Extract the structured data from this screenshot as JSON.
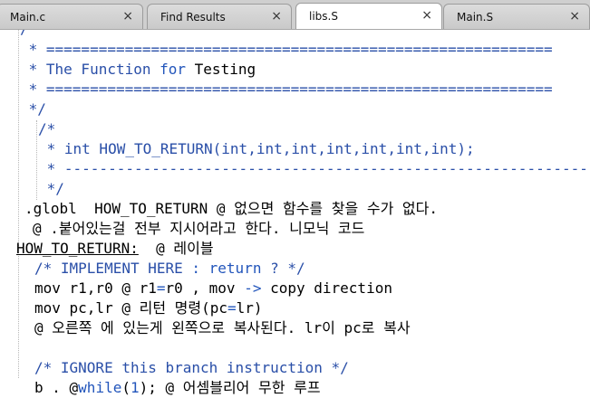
{
  "tabs": [
    {
      "label": "Main.c",
      "close": "×"
    },
    {
      "label": "Find Results",
      "close": "×"
    },
    {
      "label": "libs.S",
      "close": "×"
    },
    {
      "label": "Main.S",
      "close": "×"
    }
  ],
  "active_tab": "libs.S",
  "editor": {
    "l0": "/",
    "l1": " * ==========================================================",
    "l2a": " * The Function ",
    "l2b": "for",
    "l2c": " Testing",
    "l3": " * ==========================================================",
    "l4": " */",
    "l5": "/*",
    "l6": " * int HOW_TO_RETURN(int,int,int,int,int,int,int);",
    "l7": " * ------------------------------------------------------------",
    "l8": " */",
    "l9": ".globl  HOW_TO_RETURN @ 없으면 함수를 찾을 수가 없다.",
    "l10": "@ .붙어있는걸 전부 지시어라고 한다. 니모닉 코드",
    "l11a": "HOW_TO_RETURN:",
    "l11b": "  @ 레이블",
    "l12a": "/* IMPLEMENT HERE ",
    "l12b": ": return",
    "l12c": " ? */",
    "l13a": "mov r1,r0 @ r1",
    "l13b": "=",
    "l13c": "r0 , mov ",
    "l13d": "->",
    "l13e": " copy direction",
    "l14a": "mov pc,lr @ 리턴 명령(pc",
    "l14b": "=",
    "l14c": "lr)",
    "l15": "@ 오른쪽 에 있는게 왼쪽으로 복사된다. lr이 pc로 복사",
    "l16": "/* IGNORE this branch instruction */",
    "l17a": "b . @",
    "l17b": "while",
    "l17c": "(",
    "l17d": "1",
    "l17e": "); @ 어셈블리어 무한 루프"
  }
}
